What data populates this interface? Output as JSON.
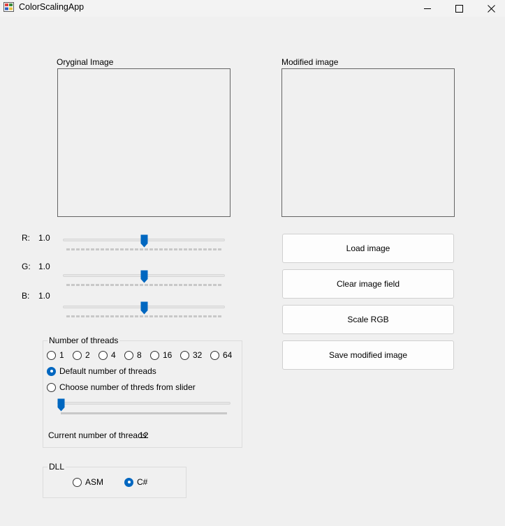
{
  "window": {
    "title": "ColorScalingApp"
  },
  "images": {
    "original_label": "Oryginal Image",
    "modified_label": "Modified image"
  },
  "sliders": {
    "r": {
      "label": "R:",
      "value": "1.0",
      "position_fraction": 0.5
    },
    "g": {
      "label": "G:",
      "value": "1.0",
      "position_fraction": 0.5
    },
    "b": {
      "label": "B:",
      "value": "1.0",
      "position_fraction": 0.5
    }
  },
  "buttons": {
    "load": "Load image",
    "clear": "Clear image field",
    "scale": "Scale RGB",
    "save": "Save modified image"
  },
  "threads": {
    "legend": "Number of threads",
    "options": [
      "1",
      "2",
      "4",
      "8",
      "16",
      "32",
      "64"
    ],
    "default_label": "Default number of threads",
    "slider_label": "Choose number of threds from slider",
    "selected": "Default number of threads",
    "thread_slider_fraction": 0,
    "current_label": "Current number of threads:",
    "current_value": "12"
  },
  "dll": {
    "legend": "DLL",
    "options": [
      "ASM",
      "C#"
    ],
    "selected": "C#"
  },
  "colors": {
    "accent": "#0067c0"
  }
}
